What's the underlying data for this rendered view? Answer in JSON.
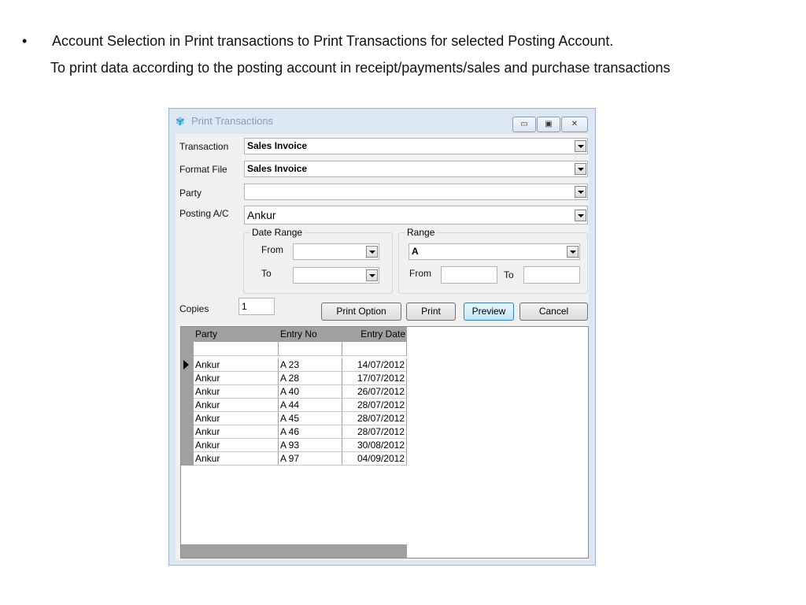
{
  "slide": {
    "bullet": "•",
    "line1": "Account Selection in Print transactions to Print Transactions for selected Posting Account.",
    "line2": "To print data according to the posting account in receipt/payments/sales and purchase transactions"
  },
  "window": {
    "title": "Print Transactions",
    "minimize": "▭",
    "maximize": "▣",
    "close": "✕"
  },
  "form": {
    "transaction_label": "Transaction",
    "transaction_value": "Sales Invoice",
    "format_label": "Format File",
    "format_value": "Sales Invoice",
    "party_label": "Party",
    "party_value": "",
    "posting_label": "Posting A/C",
    "posting_value": "Ankur",
    "date_range": {
      "title": "Date Range",
      "from_label": "From",
      "to_label": "To"
    },
    "range": {
      "title": "Range",
      "value": "A",
      "from_label": "From",
      "to_label": "To"
    },
    "copies_label": "Copies",
    "copies_value": "1"
  },
  "buttons": {
    "print_option": "Print Option",
    "print": "Print",
    "preview": "Preview",
    "cancel": "Cancel"
  },
  "grid": {
    "columns": [
      "Party",
      "Entry No",
      "Entry Date"
    ],
    "rows": [
      [
        "Ankur",
        "A 23",
        "14/07/2012"
      ],
      [
        "Ankur",
        "A 28",
        "17/07/2012"
      ],
      [
        "Ankur",
        "A 40",
        "26/07/2012"
      ],
      [
        "Ankur",
        "A 44",
        "28/07/2012"
      ],
      [
        "Ankur",
        "A 45",
        "28/07/2012"
      ],
      [
        "Ankur",
        "A 46",
        "28/07/2012"
      ],
      [
        "Ankur",
        "A 93",
        "30/08/2012"
      ],
      [
        "Ankur",
        "A 97",
        "04/09/2012"
      ]
    ]
  }
}
